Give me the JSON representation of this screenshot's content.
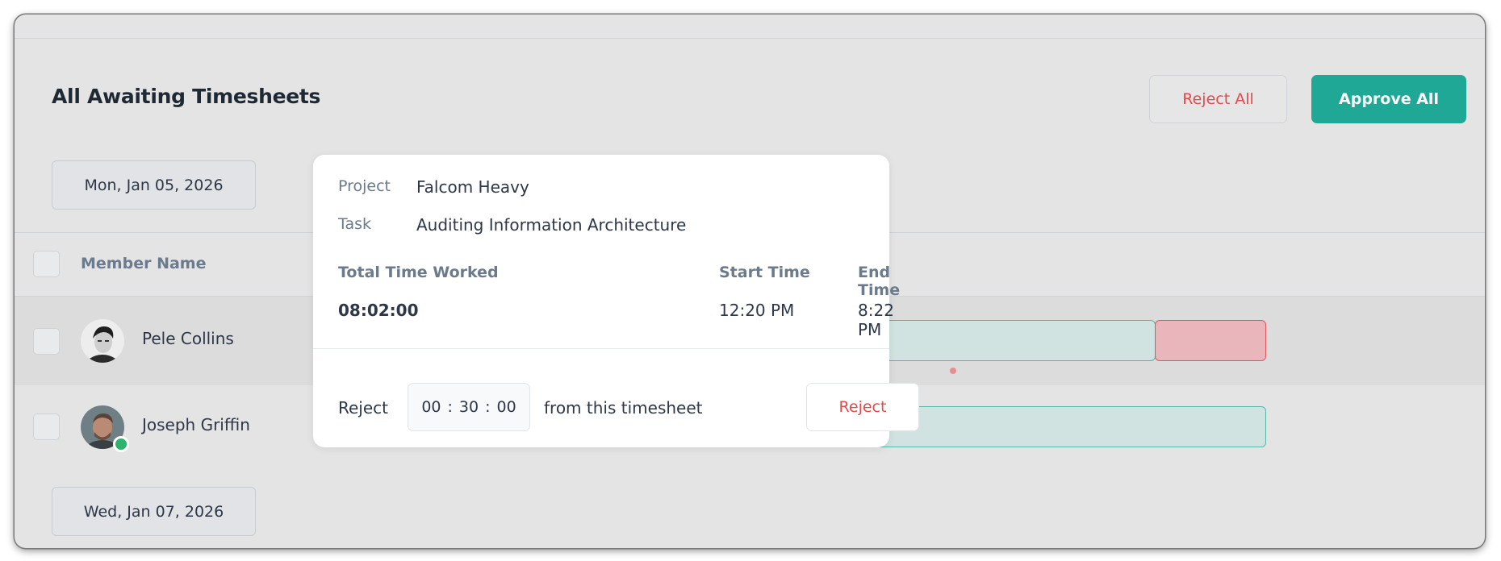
{
  "header": {
    "title": "All Awaiting Timesheets",
    "reject_all_label": "Reject All",
    "approve_all_label": "Approve All"
  },
  "dates": [
    "Mon, Jan 05, 2026",
    "Wed, Jan 07, 2026"
  ],
  "table": {
    "column_member_name": "Member Name",
    "rows": [
      {
        "name": "Pele Collins",
        "online": false
      },
      {
        "name": "Joseph Griffin",
        "online": true
      }
    ]
  },
  "popup": {
    "project_label": "Project",
    "project_value": "Falcom Heavy",
    "task_label": "Task",
    "task_value": "Auditing Information Architecture",
    "total_time_label": "Total Time Worked",
    "total_time_value": "08:02:00",
    "start_time_label": "Start Time",
    "start_time_value": "12:20 PM",
    "end_time_label": "End Time",
    "end_time_value": "8:22 PM",
    "reject_prefix": "Reject",
    "reject_hours": "00",
    "reject_minutes": "30",
    "reject_seconds": "00",
    "time_separator": ":",
    "reject_suffix": "from this timesheet",
    "reject_button_label": "Reject"
  },
  "colors": {
    "accent": "#1fa896",
    "danger": "#e24b4b",
    "bar_fill": "#d0e3e0",
    "bar_border": "#56b7a8",
    "rejected_fill": "#e9b6bc",
    "online": "#2db36b"
  }
}
